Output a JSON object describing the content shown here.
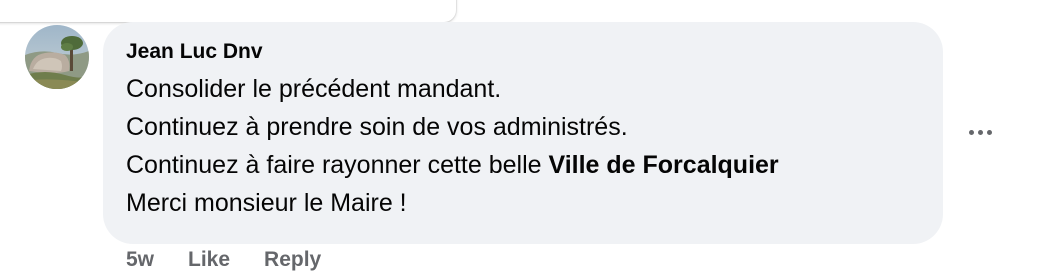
{
  "comment": {
    "author": "Jean Luc Dnv",
    "lines": [
      "Consolider le précédent mandant.",
      "Continuez à prendre soin de vos administrés.",
      "Continuez à faire rayonner cette belle "
    ],
    "mention": "Ville de Forcalquier",
    "closing": "Merci monsieur le Maire !",
    "timestamp": "5w",
    "like_label": "Like",
    "reply_label": "Reply"
  },
  "icons": {
    "avatar": "profile-photo-landscape",
    "more": "more-horizontal-icon"
  },
  "colors": {
    "bubble": "#f0f2f5",
    "text": "#050505",
    "secondary": "#65676b"
  }
}
